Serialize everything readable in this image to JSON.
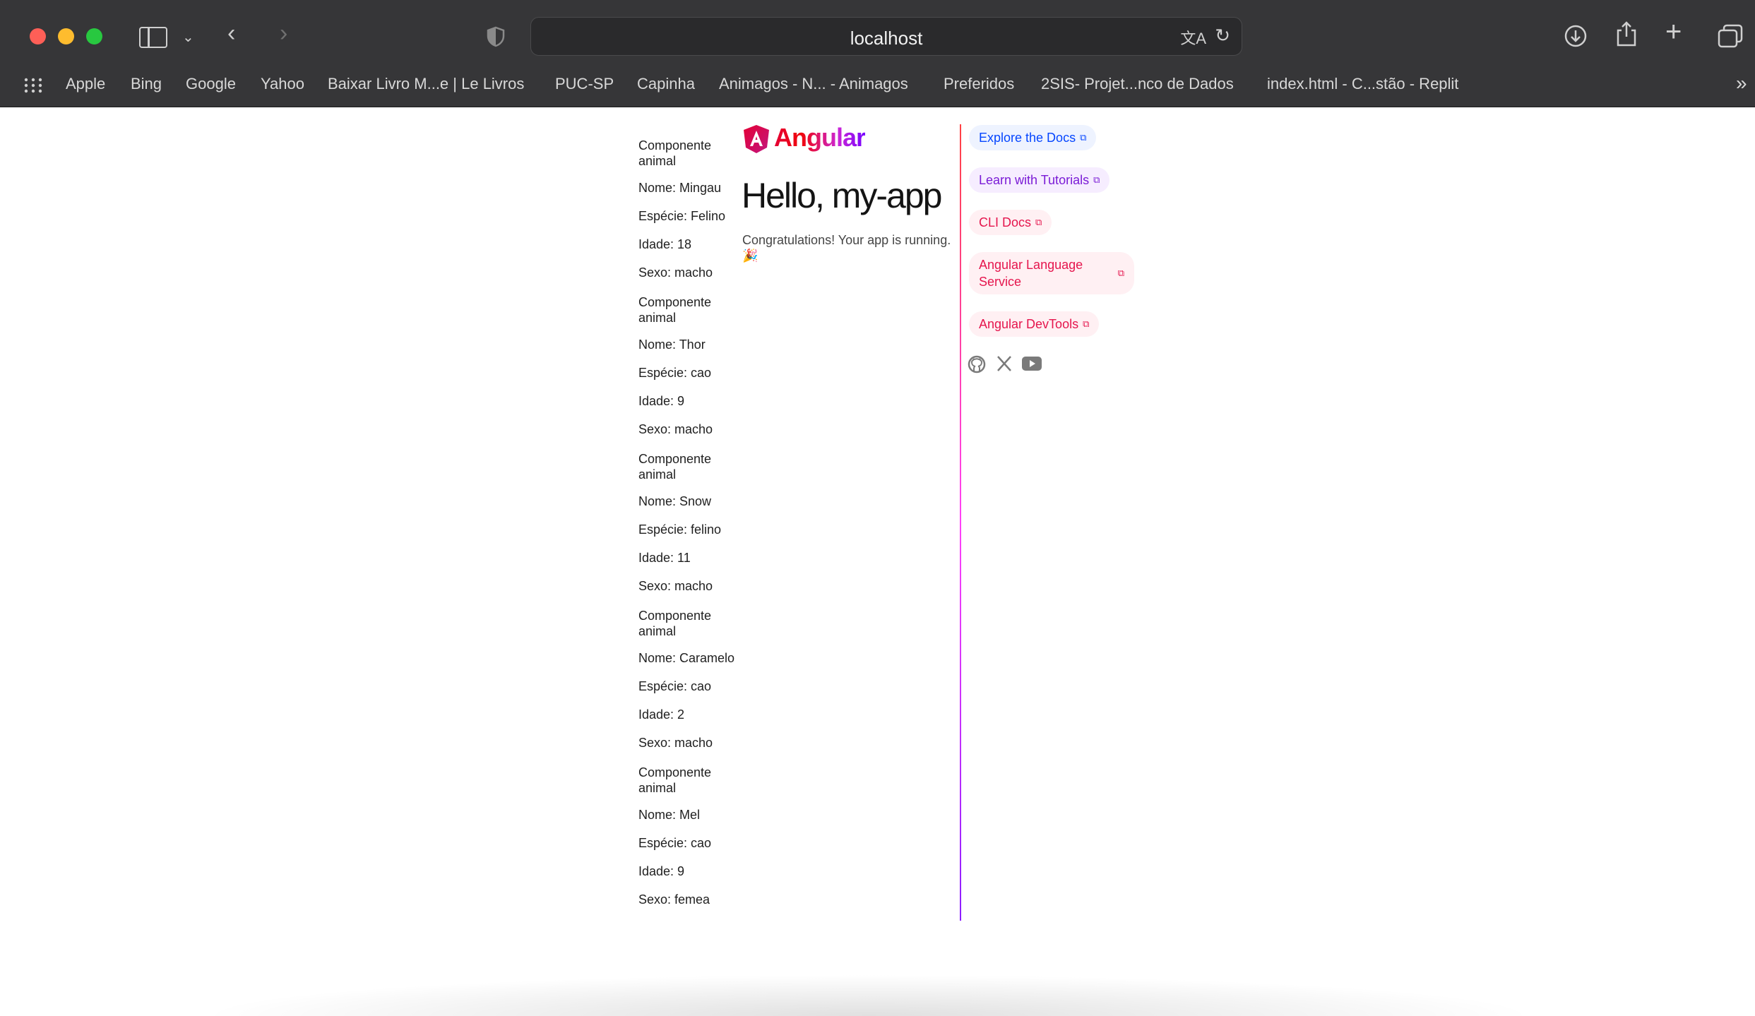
{
  "browser": {
    "url": "localhost",
    "bookmarks": [
      "Apple",
      "Bing",
      "Google",
      "Yahoo",
      "Baixar Livro M...e | Le Livros",
      "PUC-SP",
      "Capinha",
      "Animagos - N... - Animagos",
      "Preferidos",
      "2SIS- Projet...nco de Dados",
      "index.html - C...stão - Replit"
    ],
    "more_bookmarks": "»"
  },
  "animals": [
    {
      "header": "Componente animal",
      "nome": "Nome: Mingau",
      "especie": "Espécie: Felino",
      "idade": "Idade: 18",
      "sexo": "Sexo: macho"
    },
    {
      "header": "Componente animal",
      "nome": "Nome: Thor",
      "especie": "Espécie: cao",
      "idade": "Idade: 9",
      "sexo": "Sexo: macho"
    },
    {
      "header": "Componente animal",
      "nome": "Nome: Snow",
      "especie": "Espécie: felino",
      "idade": "Idade: 11",
      "sexo": "Sexo: macho"
    },
    {
      "header": "Componente animal",
      "nome": "Nome: Caramelo",
      "especie": "Espécie: cao",
      "idade": "Idade: 2",
      "sexo": "Sexo: macho"
    },
    {
      "header": "Componente animal",
      "nome": "Nome: Mel",
      "especie": "Espécie: cao",
      "idade": "Idade: 9",
      "sexo": "Sexo: femea"
    }
  ],
  "main": {
    "logo_text": "Angular",
    "title": "Hello, my-app",
    "congrats": "Congratulations! Your app is running. 🎉"
  },
  "links": [
    {
      "label": "Explore the Docs",
      "color": "#0546ff",
      "bg": "#eef3ff"
    },
    {
      "label": "Learn with Tutorials",
      "color": "#7a1bd6",
      "bg": "#f6edff"
    },
    {
      "label": "CLI Docs",
      "color": "#e5154d",
      "bg": "#fff0f3"
    },
    {
      "label": "Angular Language Service",
      "color": "#e5154d",
      "bg": "#fff0f3"
    },
    {
      "label": "Angular DevTools",
      "color": "#e5154d",
      "bg": "#fff0f3"
    }
  ],
  "social_icons": [
    "github-icon",
    "x-icon",
    "youtube-icon"
  ]
}
